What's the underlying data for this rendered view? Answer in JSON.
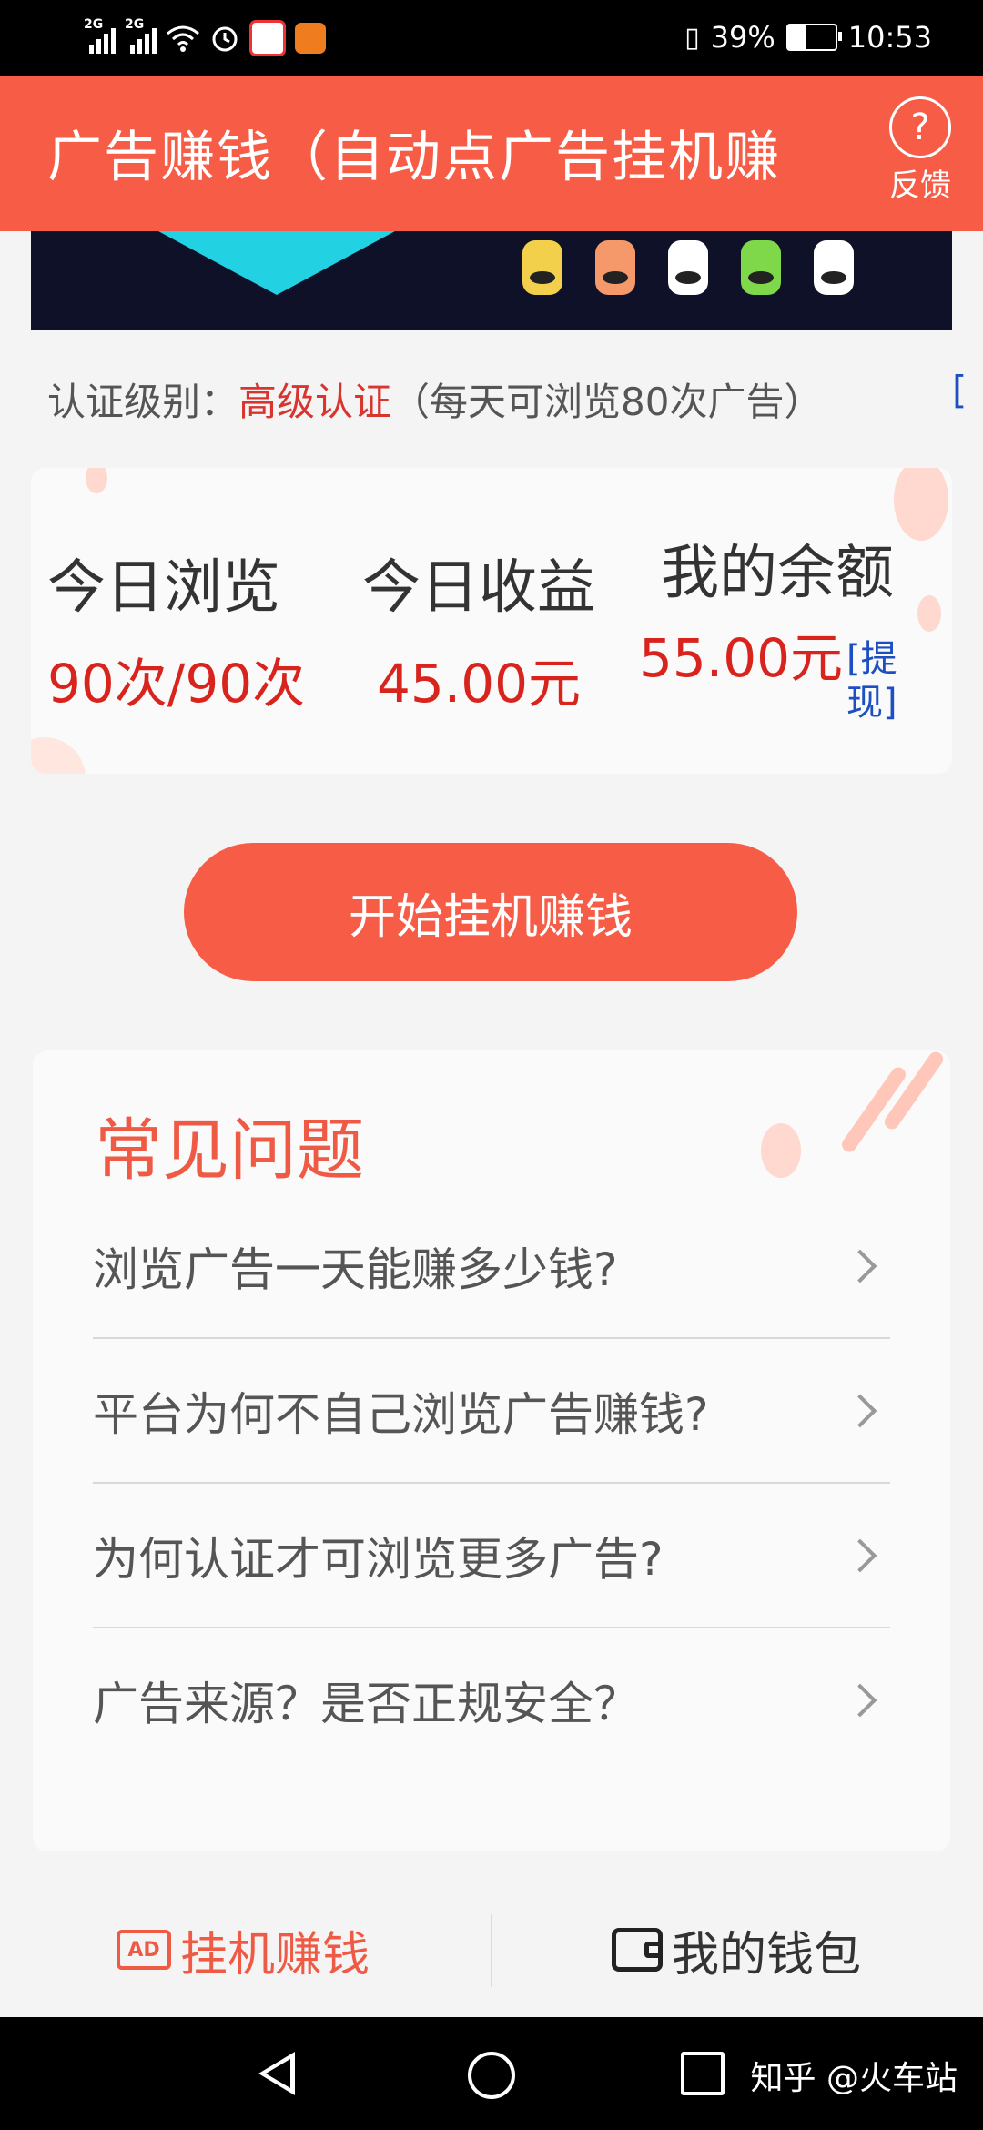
{
  "status_bar": {
    "network_1": "2G",
    "network_2": "2G",
    "battery": "39%",
    "battery_level": 0.39,
    "time": "10:53"
  },
  "header": {
    "title": "广告赚钱（自动点广告挂机赚",
    "help_symbol": "?",
    "feedback_label": "反馈"
  },
  "verification": {
    "prefix": "认证级别：",
    "level": "高级认证",
    "note": "（每天可浏览80次广告）",
    "trailing": "[",
    "level_color": "#d9352e"
  },
  "stats": {
    "today_views": {
      "label": "今日浏览",
      "value": "90次/90次"
    },
    "today_income": {
      "label": "今日收益",
      "value": "45.00元"
    },
    "balance": {
      "label": "我的余额",
      "value": "55.00元"
    },
    "withdraw_link": "[提现]"
  },
  "start_button": {
    "label": "开始挂机赚钱"
  },
  "faq": {
    "title": "常见问题",
    "items": [
      "浏览广告一天能赚多少钱?",
      "平台为何不自己浏览广告赚钱?",
      "为何认证才可浏览更多广告?",
      "广告来源？是否正规安全？"
    ]
  },
  "tabs": {
    "earn": {
      "icon_text": "AD",
      "label": "挂机赚钱"
    },
    "wallet": {
      "label": "我的钱包"
    }
  },
  "nav_bar": {
    "watermark": "知乎 @火车站"
  },
  "colors": {
    "accent": "#f65c46",
    "value_red": "#d8241d",
    "link_blue": "#1d4fc1"
  }
}
